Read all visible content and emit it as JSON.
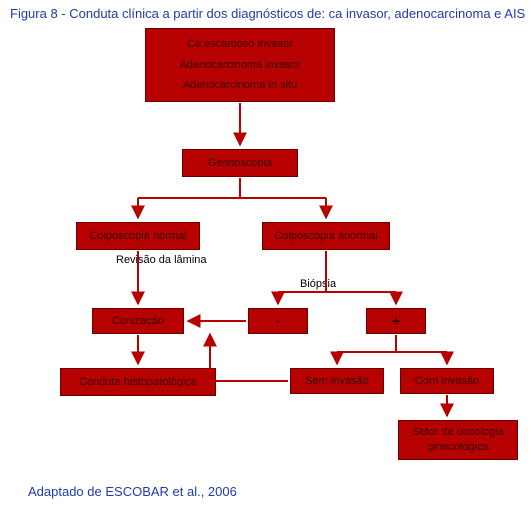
{
  "title": "Figura 8 - Conduta clínica a partir dos diagnósticos de: ca invasor, adenocarcinoma e AIS",
  "footer": "Adaptado de ESCOBAR et al., 2006",
  "nodes": {
    "diag1": "Ca escamoso invasor",
    "diag2": "Adenocarcinoma invasor",
    "diag3": "Adenocarcinoma in situ",
    "genitoscopia": "Genitoscopia",
    "colp_normal": "Colposcopia normal",
    "colp_anormal": "Colposcopia anormal",
    "conizacao": "Conização",
    "minus": "-",
    "plus": "+",
    "cond_histo": "Conduta histopatológica",
    "sem_inv": "Sem invasão",
    "com_inv": "Com invasão",
    "oncologia": "Setor de oncologia ginecológica"
  },
  "labels": {
    "revisao": "Revisão da lâmina",
    "biopsia": "Biópsia"
  },
  "arrow_color": "#b70000"
}
